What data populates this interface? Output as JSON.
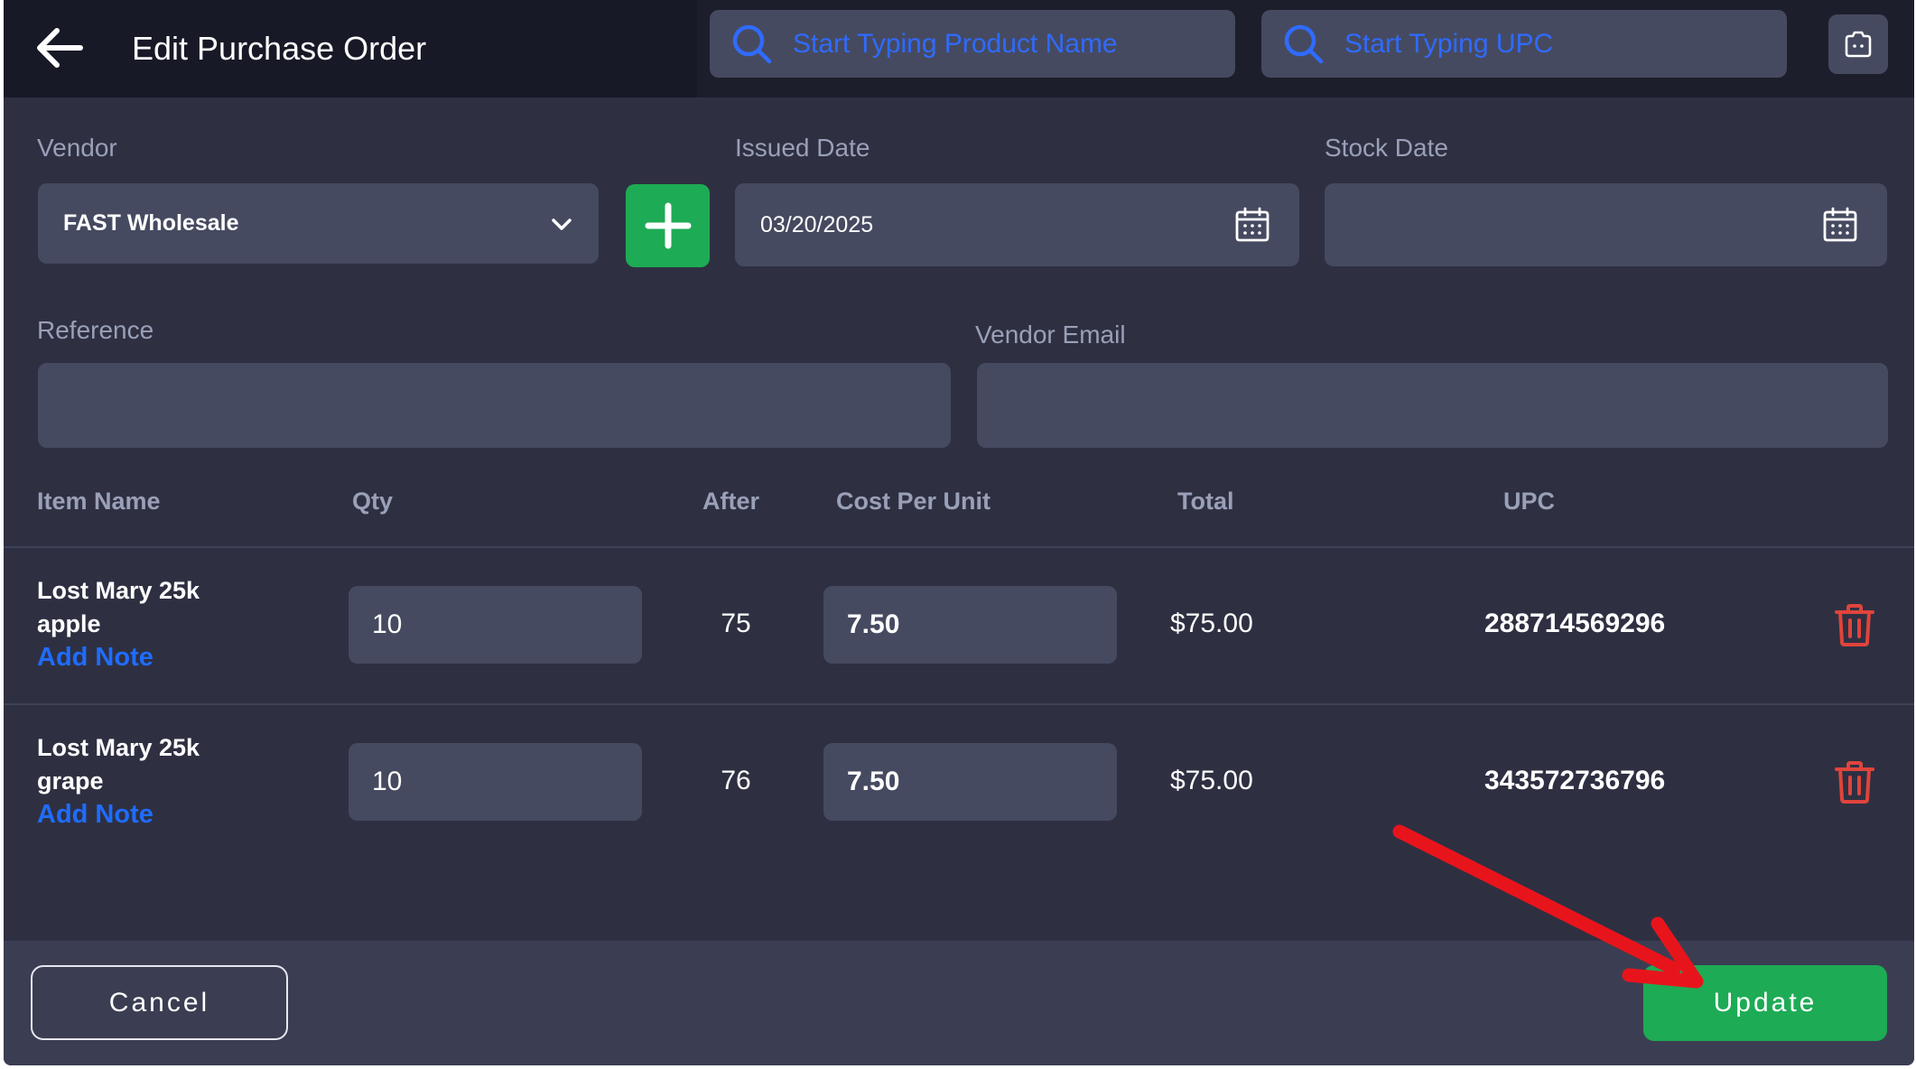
{
  "header": {
    "title": "Edit Purchase Order",
    "product_search_placeholder": "Start Typing Product Name",
    "upc_search_placeholder": "Start Typing UPC"
  },
  "form": {
    "vendor_label": "Vendor",
    "vendor_value": "FAST Wholesale",
    "issued_date_label": "Issued Date",
    "issued_date_value": "03/20/2025",
    "stock_date_label": "Stock Date",
    "stock_date_value": "",
    "reference_label": "Reference",
    "reference_value": "",
    "vendor_email_label": "Vendor Email",
    "vendor_email_value": ""
  },
  "table": {
    "columns": [
      "Item Name",
      "Qty",
      "After",
      "Cost Per Unit",
      "Total",
      "UPC"
    ],
    "rows": [
      {
        "name_line1": "Lost Mary 25k",
        "name_line2": "apple",
        "note_link": "Add Note",
        "qty": "10",
        "after": "75",
        "cost": "7.50",
        "total": "$75.00",
        "upc": "288714569296"
      },
      {
        "name_line1": "Lost Mary 25k",
        "name_line2": "grape",
        "note_link": "Add Note",
        "qty": "10",
        "after": "76",
        "cost": "7.50",
        "total": "$75.00",
        "upc": "343572736796"
      }
    ]
  },
  "footer": {
    "cancel_label": "Cancel",
    "update_label": "Update"
  },
  "colors": {
    "accent_green": "#1eab55",
    "link_blue": "#1f6cff",
    "delete_red": "#e0443b",
    "annotation_arrow": "#e8141c"
  }
}
